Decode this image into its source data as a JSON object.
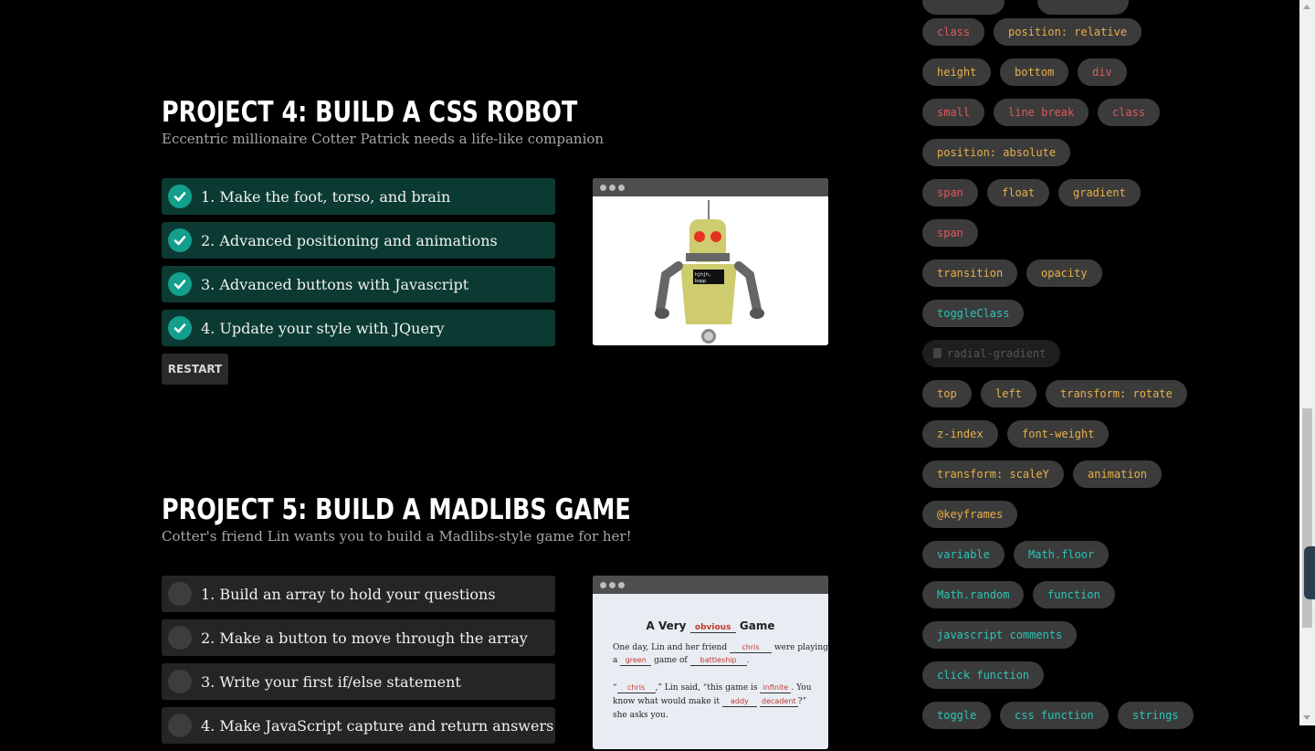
{
  "project4": {
    "title": "PROJECT 4: BUILD A CSS ROBOT",
    "subtitle": "Eccentric millionaire Cotter Patrick needs a life-like companion",
    "steps": [
      {
        "label": "1. Make the foot, torso, and brain",
        "done": true
      },
      {
        "label": "2. Advanced positioning and animations",
        "done": true
      },
      {
        "label": "3. Advanced buttons with Javascript",
        "done": true
      },
      {
        "label": "4. Update your style with JQuery",
        "done": true
      }
    ],
    "restart_label": "RESTART",
    "robot_screen_text": "hjhjh, bopp"
  },
  "project5": {
    "title": "PROJECT 5: BUILD A MADLIBS GAME",
    "subtitle": "Cotter's friend Lin wants you to build a Madlibs-style game for her!",
    "steps": [
      {
        "label": "1. Build an array to hold your questions",
        "done": false
      },
      {
        "label": "2. Make a button to move through the array",
        "done": false
      },
      {
        "label": "3. Write your first if/else statement",
        "done": false
      },
      {
        "label": "4. Make JavaScript capture and return answers",
        "done": false
      }
    ],
    "madlib": {
      "title_a": "A Very",
      "title_blank": "obvious",
      "title_b": "Game",
      "l1a": "One day, Lin and her friend",
      "l1blank": "chris",
      "l1b": "were playing",
      "l2a": "a",
      "l2blank1": "green",
      "l2b": "game of",
      "l2blank2": "battleship",
      "l2c": ".",
      "l3a": "“",
      "l3blank1": "chris",
      "l3b": ",” Lin said, “this game is",
      "l3blank2": "infinite",
      "l3c": ". You",
      "l4a": "know what would make it",
      "l4blank1": "addy",
      "l4blank2": "decadent",
      "l4b": "?”",
      "l5": "she asks you."
    }
  },
  "sidebar": {
    "tags": [
      {
        "label": "class",
        "color": "#e05a5a"
      },
      {
        "label": "position: relative",
        "color": "#e8b04a"
      },
      {
        "label": "height",
        "color": "#e8b04a"
      },
      {
        "label": "bottom",
        "color": "#e8b04a"
      },
      {
        "label": "div",
        "color": "#e05a5a"
      },
      {
        "label": "small",
        "color": "#e05a5a"
      },
      {
        "label": "line break",
        "color": "#e05a5a"
      },
      {
        "label": "class",
        "color": "#e05a5a"
      },
      {
        "label": "position: absolute",
        "color": "#e8b04a"
      },
      {
        "label": "span",
        "color": "#e05a5a"
      },
      {
        "label": "float",
        "color": "#e8b04a"
      },
      {
        "label": "gradient",
        "color": "#e8b04a"
      },
      {
        "label": "span",
        "color": "#e05a5a"
      },
      {
        "label": "transition",
        "color": "#e8b04a"
      },
      {
        "label": "opacity",
        "color": "#e8b04a"
      },
      {
        "label": "toggleClass",
        "color": "#2ec4b6"
      },
      {
        "label": "radial-gradient",
        "color": "#555555",
        "locked": true
      },
      {
        "label": "top",
        "color": "#e8b04a"
      },
      {
        "label": "left",
        "color": "#e8b04a"
      },
      {
        "label": "transform: rotate",
        "color": "#e8b04a"
      },
      {
        "label": "z-index",
        "color": "#e8b04a"
      },
      {
        "label": "font-weight",
        "color": "#e8b04a"
      },
      {
        "label": "transform: scaleY",
        "color": "#e8b04a"
      },
      {
        "label": "animation",
        "color": "#e8b04a"
      },
      {
        "label": "@keyframes",
        "color": "#e8b04a"
      },
      {
        "label": "variable",
        "color": "#2ec4b6"
      },
      {
        "label": "Math.floor",
        "color": "#2ec4b6"
      },
      {
        "label": "Math.random",
        "color": "#2ec4b6"
      },
      {
        "label": "function",
        "color": "#2ec4b6"
      },
      {
        "label": "javascript comments",
        "color": "#2ec4b6"
      },
      {
        "label": "click function",
        "color": "#2ec4b6"
      },
      {
        "label": "toggle",
        "color": "#2ec4b6"
      },
      {
        "label": "css function",
        "color": "#2ec4b6"
      },
      {
        "label": "strings",
        "color": "#2ec4b6"
      }
    ]
  }
}
